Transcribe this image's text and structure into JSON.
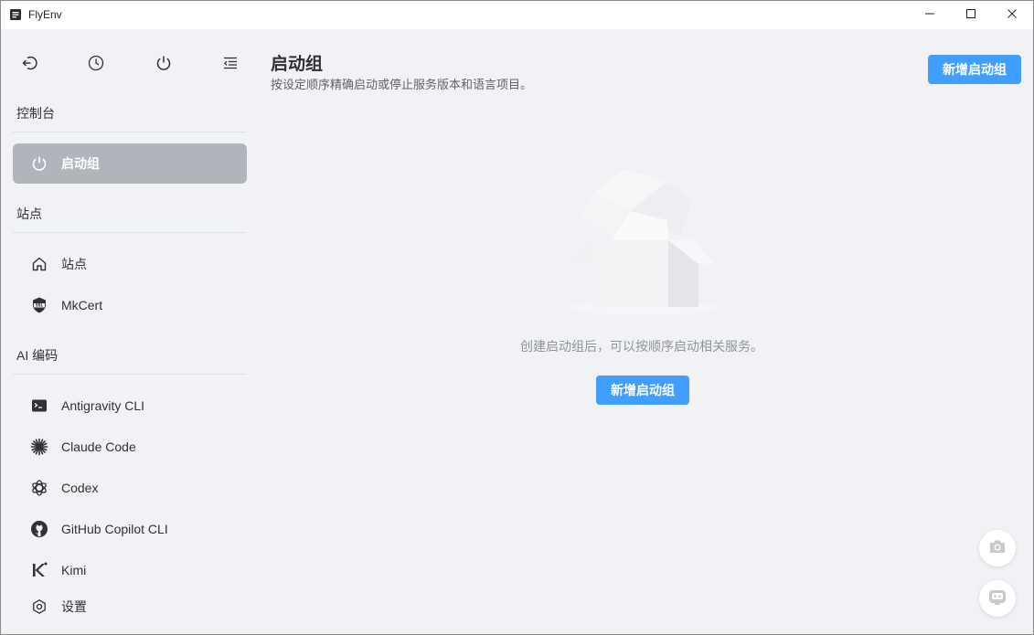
{
  "window": {
    "title": "FlyEnv",
    "minimize_icon": "minimize-icon",
    "maximize_icon": "maximize-icon",
    "close_icon": "close-icon"
  },
  "sidebar": {
    "top_icons": [
      "logout-icon",
      "clock-icon",
      "power-icon",
      "collapse-menu-icon"
    ],
    "sections": [
      {
        "title": "控制台",
        "items": [
          {
            "label": "启动组",
            "icon": "power-icon",
            "active": true
          }
        ]
      },
      {
        "title": "站点",
        "items": [
          {
            "label": "站点",
            "icon": "home-icon"
          },
          {
            "label": "MkCert",
            "icon": "ssl-shield-icon"
          }
        ]
      },
      {
        "title": "AI 编码",
        "items": [
          {
            "label": "Antigravity CLI",
            "icon": "terminal-icon"
          },
          {
            "label": "Claude Code",
            "icon": "claude-icon"
          },
          {
            "label": "Codex",
            "icon": "openai-icon"
          },
          {
            "label": "GitHub Copilot CLI",
            "icon": "github-icon"
          },
          {
            "label": "Kimi",
            "icon": "kimi-icon"
          },
          {
            "label": "设置",
            "icon": "settings-icon"
          }
        ]
      }
    ]
  },
  "main": {
    "title": "启动组",
    "subtitle": "按设定顺序精确启动或停止服务版本和语言项目。",
    "add_button": "新增启动组",
    "empty_description": "创建启动组后，可以按顺序启动相关服务。",
    "empty_add_button": "新增启动组"
  },
  "floating": {
    "camera_icon": "camera-icon",
    "robot_icon": "robot-icon"
  },
  "colors": {
    "primary": "#409eff",
    "active_nav": "#b1b4ba",
    "background": "#f0f2f5"
  }
}
